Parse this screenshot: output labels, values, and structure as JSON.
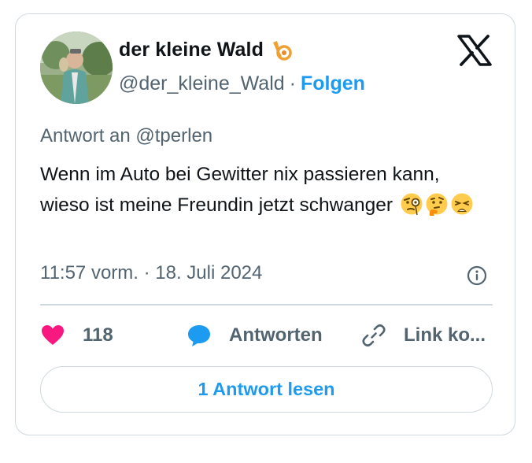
{
  "author": {
    "display_name": "der kleine Wald",
    "name_emoji": "horn-emoji",
    "handle": "@der_kleine_Wald",
    "separator": "·",
    "follow_label": "Folgen"
  },
  "reply_to": "Antwort an @tperlen",
  "tweet": {
    "text": "Wenn im Auto bei Gewitter nix passieren kann, wieso ist meine Freundin jetzt schwanger",
    "emojis": [
      "face-with-monocle-emoji",
      "thinking-face-emoji",
      "weary-face-emoji"
    ]
  },
  "timestamp": "11:57 vorm. · 18. Juli 2024",
  "actions": {
    "like_count": "118",
    "reply_label": "Antworten",
    "link_label": "Link ko..."
  },
  "read_replies_label": "1 Antwort lesen",
  "colors": {
    "accent": "#1d9bf0",
    "like": "#f91880",
    "text": "#0f1419",
    "muted": "#536471",
    "border": "#cfd9de"
  },
  "icons": [
    "x-logo-icon",
    "info-icon",
    "heart-icon",
    "speech-bubble-icon",
    "link-icon"
  ]
}
